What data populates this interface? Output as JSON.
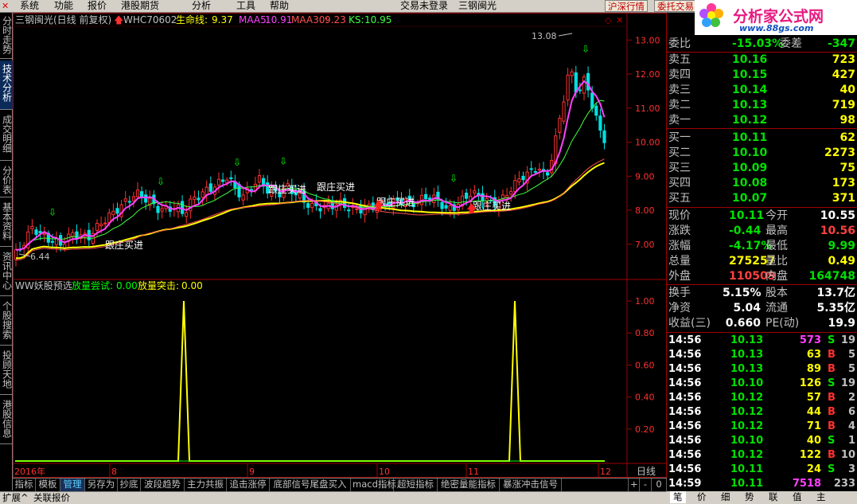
{
  "menubar": {
    "items": [
      "系统",
      "功能",
      "报价",
      "港股期货",
      "分析",
      "工具",
      "帮助"
    ],
    "login_status": "交易未登录",
    "stock_name": "三钢闽光",
    "btn_market": "沪深行情",
    "btn_trade": "委托交易"
  },
  "brand": {
    "title": "分析家公式网",
    "url": "www.88gs.com"
  },
  "left_tabs": [
    "分时走势",
    "技术分析",
    "成交明细",
    "分价表",
    "基本资料",
    "资讯中心",
    "个股搜索",
    "投顾天地",
    "港股信息"
  ],
  "main_header": {
    "title": "三钢闽光(日线 前复权)",
    "code": "WHC70602",
    "lifeline_label": "生命线:",
    "lifeline_value": "9.37",
    "maa5_label": "MAA5:",
    "maa5_value": "10.91",
    "maa30_label": "MAA30:",
    "maa30_value": "9.23",
    "ks_label": "KS:",
    "ks_value": "10.95"
  },
  "sub_header": {
    "title": "WW妖股预选",
    "s1_label": "放量尝试:",
    "s1_value": "0.00",
    "s2_label": "放量突击:",
    "s2_value": "0.00"
  },
  "annotations": {
    "buy_label": "跟庄买进",
    "low_label": "6.44",
    "high_label": "13.08"
  },
  "period_label": "日线",
  "chart_data": [
    {
      "type": "candlestick",
      "title": "三钢闽光(日线 前复权)",
      "y_ticks": [
        "13.00",
        "12.00",
        "11.00",
        "10.00",
        "9.00",
        "8.00",
        "7.00"
      ],
      "ylim": [
        6.2,
        13.1
      ],
      "x_ticks": [
        "2016年",
        "8",
        "9",
        "10",
        "11",
        "12"
      ],
      "high": 13.08,
      "low": 6.44,
      "series": [
        {
          "name": "生命线",
          "color": "#ffff00",
          "value": 9.37
        },
        {
          "name": "MAA5",
          "color": "#ff40ff",
          "value": 10.91
        },
        {
          "name": "MAA30",
          "color": "#ff5050",
          "value": 9.23
        },
        {
          "name": "KS",
          "color": "#40ff40",
          "value": 10.95
        }
      ]
    },
    {
      "type": "line",
      "title": "WW妖股预选",
      "y_ticks": [
        "1.00",
        "0.80",
        "0.60",
        "0.40",
        "0.20"
      ],
      "ylim": [
        0,
        1.05
      ],
      "series": [
        {
          "name": "放量尝试",
          "value": 0.0
        },
        {
          "name": "放量突击",
          "value": 0.0
        }
      ]
    }
  ],
  "quote": {
    "webi_label": "委比",
    "webi_value": "-15.03%",
    "wecha_label": "委差",
    "wecha_value": "-347",
    "asks": [
      {
        "label": "卖五",
        "price": "10.16",
        "vol": "723"
      },
      {
        "label": "卖四",
        "price": "10.15",
        "vol": "427"
      },
      {
        "label": "卖三",
        "price": "10.14",
        "vol": "40"
      },
      {
        "label": "卖二",
        "price": "10.13",
        "vol": "719"
      },
      {
        "label": "卖一",
        "price": "10.12",
        "vol": "98"
      }
    ],
    "bids": [
      {
        "label": "买一",
        "price": "10.11",
        "vol": "62"
      },
      {
        "label": "买二",
        "price": "10.10",
        "vol": "2273"
      },
      {
        "label": "买三",
        "price": "10.09",
        "vol": "75"
      },
      {
        "label": "买四",
        "price": "10.08",
        "vol": "173"
      },
      {
        "label": "买五",
        "price": "10.07",
        "vol": "371"
      }
    ],
    "stats1": [
      {
        "l1": "现价",
        "v1": "10.11",
        "c1": "#00e000",
        "l2": "今开",
        "v2": "10.55",
        "c2": "#ffffff"
      },
      {
        "l1": "涨跌",
        "v1": "-0.44",
        "c1": "#00e000",
        "l2": "最高",
        "v2": "10.56",
        "c2": "#ff4040"
      },
      {
        "l1": "涨幅",
        "v1": "-4.17%",
        "c1": "#00e000",
        "l2": "最低",
        "v2": "9.99",
        "c2": "#00e000"
      },
      {
        "l1": "总量",
        "v1": "275257",
        "c1": "#ffff00",
        "l2": "量比",
        "v2": "0.49",
        "c2": "#ffff00"
      },
      {
        "l1": "外盘",
        "v1": "110509",
        "c1": "#ff4040",
        "l2": "内盘",
        "v2": "164748",
        "c2": "#00e000"
      }
    ],
    "stats2": [
      {
        "l1": "换手",
        "v1": "5.15%",
        "l2": "股本",
        "v2": "13.7亿"
      },
      {
        "l1": "净资",
        "v1": "5.04",
        "l2": "流通",
        "v2": "5.35亿"
      },
      {
        "l1": "收益(三)",
        "v1": "0.660",
        "l2": "PE(动)",
        "v2": "19.9"
      }
    ],
    "ticks": [
      {
        "t": "14:56",
        "p": "10.13",
        "v": "573",
        "d": "S",
        "n": "19",
        "vc": "#ff40ff"
      },
      {
        "t": "14:56",
        "p": "10.13",
        "v": "63",
        "d": "B",
        "n": "5",
        "vc": "#ffff00"
      },
      {
        "t": "14:56",
        "p": "10.13",
        "v": "89",
        "d": "B",
        "n": "5",
        "vc": "#ffff00"
      },
      {
        "t": "14:56",
        "p": "10.10",
        "v": "126",
        "d": "S",
        "n": "19",
        "vc": "#ffff00"
      },
      {
        "t": "14:56",
        "p": "10.12",
        "v": "57",
        "d": "B",
        "n": "2",
        "vc": "#ffff00"
      },
      {
        "t": "14:56",
        "p": "10.12",
        "v": "44",
        "d": "B",
        "n": "6",
        "vc": "#ffff00"
      },
      {
        "t": "14:56",
        "p": "10.12",
        "v": "71",
        "d": "B",
        "n": "4",
        "vc": "#ffff00"
      },
      {
        "t": "14:56",
        "p": "10.10",
        "v": "40",
        "d": "S",
        "n": "1",
        "vc": "#ffff00"
      },
      {
        "t": "14:56",
        "p": "10.12",
        "v": "122",
        "d": "B",
        "n": "10",
        "vc": "#ffff00"
      },
      {
        "t": "14:56",
        "p": "10.11",
        "v": "24",
        "d": "S",
        "n": "3",
        "vc": "#ffff00"
      },
      {
        "t": "14:59",
        "p": "10.11",
        "v": "7518",
        "d": "",
        "n": "233",
        "vc": "#ff40ff"
      }
    ]
  },
  "bottom_tabs": [
    "指标",
    "模板",
    "管理",
    "另存为",
    "抄底",
    "波段趋势",
    "主力共振",
    "追击涨停",
    "底部信号尾盘买入",
    "macd指标",
    "超短指标",
    "绝密量能指标",
    "暴涨冲击信号"
  ],
  "zoom_controls": [
    "+",
    "-",
    "0"
  ],
  "status_bar": {
    "items": [
      "扩展^",
      "关联报价"
    ]
  },
  "right_tabs": [
    "笔",
    "价",
    "细",
    "势",
    "联",
    "值",
    "主"
  ]
}
